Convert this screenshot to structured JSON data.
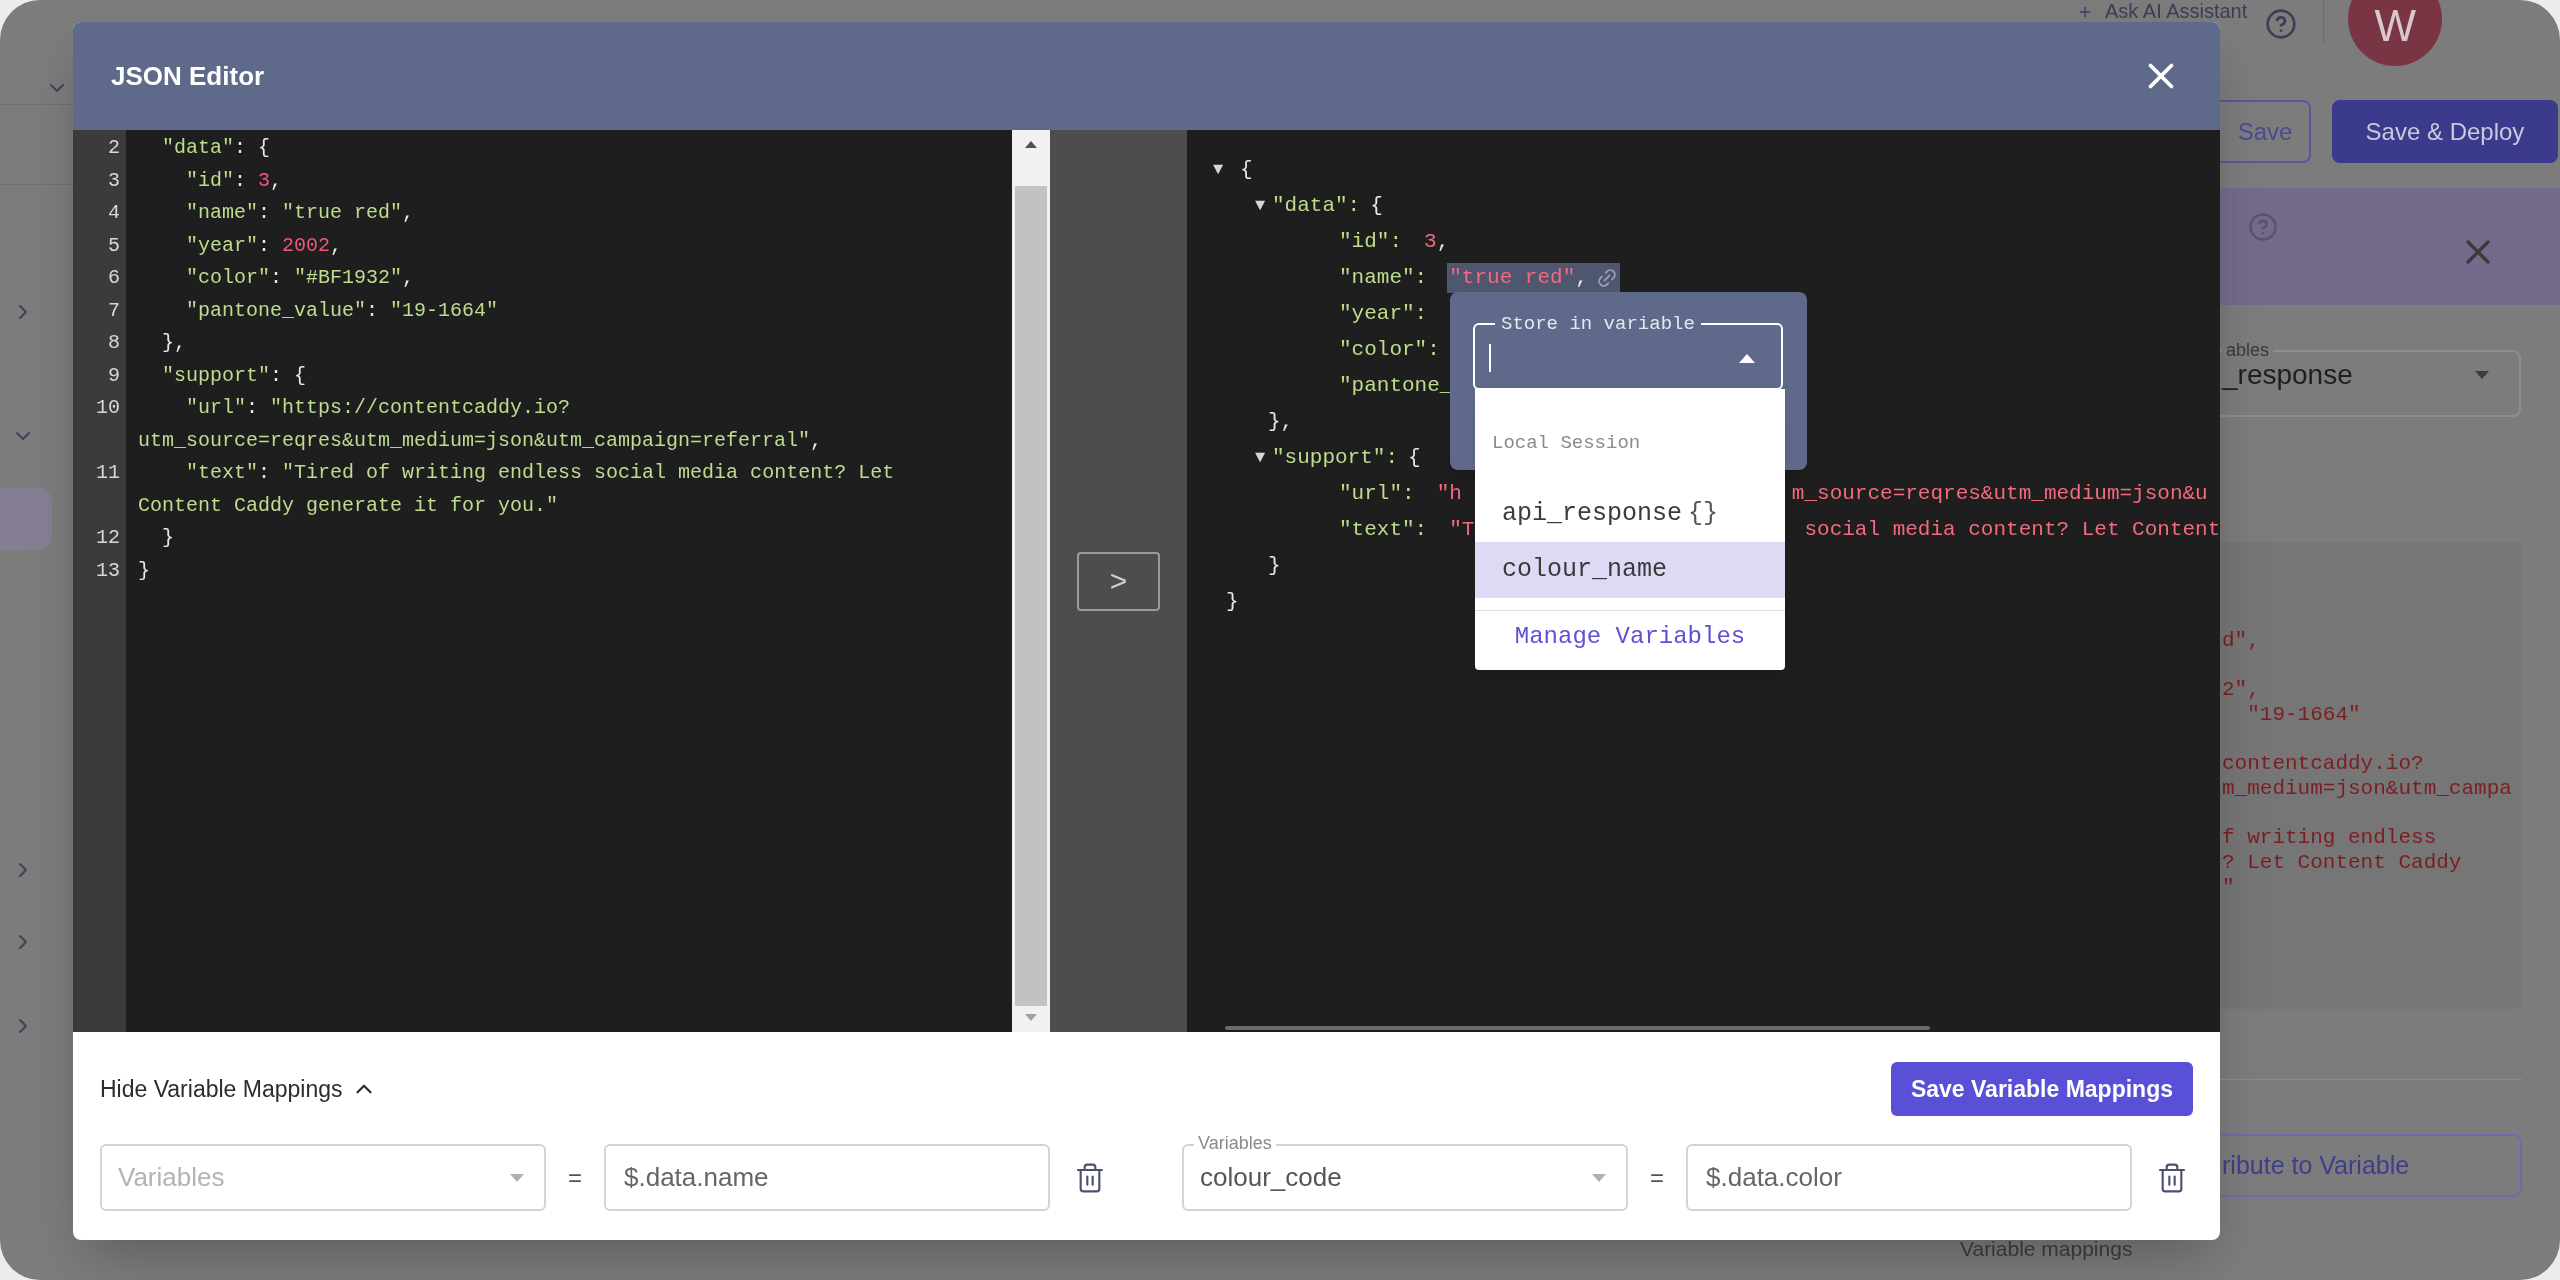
{
  "background": {
    "sidebar": [
      {
        "expanded": true
      },
      {
        "expanded": false
      },
      {
        "expanded": true
      },
      {
        "expanded": false
      },
      {
        "expanded": false
      },
      {
        "expanded": false
      }
    ],
    "ai_assistant": "Ask AI Assistant",
    "avatar_initial": "W",
    "save_button": "Save",
    "deploy_button": "Save & Deploy",
    "variables_field": {
      "label": "ables",
      "value": "_response"
    },
    "code_preview": [
      [
        "d\","
      ],
      [
        "2\",",
        "  \"19-1664\""
      ],
      [
        "contentcaddy.io?",
        "m_medium=json&utm_campa"
      ],
      [
        "f writing endless",
        "? Let Content Caddy",
        "\""
      ]
    ],
    "attribute_button": "ribute to Variable",
    "mappings_heading": "Variable mappings"
  },
  "modal": {
    "title": "JSON Editor",
    "editor_rows": [
      {
        "number": "2",
        "tokens": [
          {
            "kind": "string",
            "text": "  \"data\""
          },
          {
            "kind": "punct",
            "text": ": {"
          }
        ]
      },
      {
        "number": "3",
        "tokens": [
          {
            "kind": "string",
            "text": "    \"id\""
          },
          {
            "kind": "punct",
            "text": ": "
          },
          {
            "kind": "number",
            "text": "3"
          },
          {
            "kind": "punct",
            "text": ","
          }
        ]
      },
      {
        "number": "4",
        "tokens": [
          {
            "kind": "string",
            "text": "    \"name\""
          },
          {
            "kind": "punct",
            "text": ": "
          },
          {
            "kind": "string",
            "text": "\"true red\""
          },
          {
            "kind": "punct",
            "text": ","
          }
        ]
      },
      {
        "number": "5",
        "tokens": [
          {
            "kind": "string",
            "text": "    \"year\""
          },
          {
            "kind": "punct",
            "text": ": "
          },
          {
            "kind": "number",
            "text": "2002"
          },
          {
            "kind": "punct",
            "text": ","
          }
        ]
      },
      {
        "number": "6",
        "tokens": [
          {
            "kind": "string",
            "text": "    \"color\""
          },
          {
            "kind": "punct",
            "text": ": "
          },
          {
            "kind": "string",
            "text": "\"#BF1932\""
          },
          {
            "kind": "punct",
            "text": ","
          }
        ]
      },
      {
        "number": "7",
        "tokens": [
          {
            "kind": "string",
            "text": "    \"pantone_value\""
          },
          {
            "kind": "punct",
            "text": ": "
          },
          {
            "kind": "string",
            "text": "\"19-1664\""
          }
        ]
      },
      {
        "number": "8",
        "tokens": [
          {
            "kind": "punct",
            "text": "  },"
          }
        ]
      },
      {
        "number": "9",
        "tokens": [
          {
            "kind": "string",
            "text": "  \"support\""
          },
          {
            "kind": "punct",
            "text": ": {"
          }
        ]
      },
      {
        "number": "10",
        "tokens": [
          {
            "kind": "string",
            "text": "    \"url\""
          },
          {
            "kind": "punct",
            "text": ": "
          },
          {
            "kind": "string",
            "text": "\"https://contentcaddy.io?"
          }
        ]
      },
      {
        "tokens": [
          {
            "kind": "string",
            "text": "utm_source=reqres&utm_medium=json&utm_campaign=referral\""
          },
          {
            "kind": "punct",
            "text": ","
          }
        ]
      },
      {
        "number": "11",
        "tokens": [
          {
            "kind": "string",
            "text": "    \"text\""
          },
          {
            "kind": "punct",
            "text": ": "
          },
          {
            "kind": "string",
            "text": "\"Tired of writing endless social media content? Let"
          }
        ]
      },
      {
        "tokens": [
          {
            "kind": "string",
            "text": "Content Caddy generate it for you.\""
          }
        ]
      },
      {
        "number": "12",
        "tokens": [
          {
            "kind": "punct",
            "text": "  }"
          }
        ]
      },
      {
        "number": "13",
        "tokens": [
          {
            "kind": "punct",
            "text": "}"
          }
        ]
      }
    ],
    "transfer_button": ">",
    "tree": {
      "toggle": "▼",
      "open": "{",
      "close": "}",
      "children": [
        {
          "toggle": "▼",
          "key": "\"data\":",
          "open": "{",
          "close": "},",
          "children": [
            {
              "key": "\"id\":",
              "value": "3",
              "trail": ",",
              "selected": false
            },
            {
              "key": "\"name\":",
              "value": "\"true red\"",
              "trail": ",",
              "selected": true
            },
            {
              "key": "\"year\":"
            },
            {
              "key": "\"color\":"
            },
            {
              "key": "\"pantone_"
            }
          ]
        },
        {
          "toggle": "▼",
          "key": "\"support\":",
          "open": "{",
          "close": "}",
          "children": [
            {
              "key": "\"url\":",
              "value": "\"h",
              "value_end": "m_source=reqres&utm_medium=json&u",
              "selected": false
            },
            {
              "key": "\"text\":",
              "value": "\"T",
              "value_end": "social media content? Let Content",
              "selected": false
            }
          ]
        }
      ]
    },
    "popup": {
      "label": "Store in variable",
      "group": "Local Session",
      "options": [
        {
          "name": "api_response",
          "suffix": "{}",
          "selected": false
        },
        {
          "name": "colour_name",
          "selected": true
        }
      ],
      "footer": "Manage Variables"
    },
    "mappings_toggle": {
      "label": "Hide Variable Mappings",
      "expanded": true
    },
    "save_mappings": "Save Variable Mappings",
    "mappings": [
      {
        "variable": {
          "placeholder": "Variables"
        },
        "equals": "=",
        "path": "$.data.name"
      },
      {
        "variable": {
          "label": "Variables",
          "value": "colour_code"
        },
        "equals": "=",
        "path": "$.data.color"
      }
    ]
  }
}
